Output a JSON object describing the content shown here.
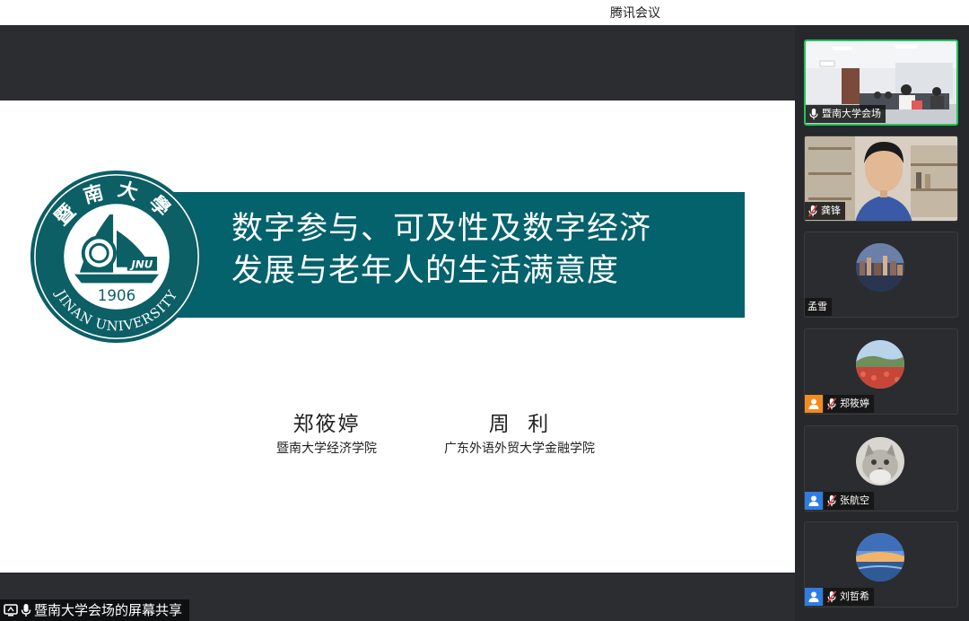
{
  "window": {
    "title": "腾讯会议"
  },
  "slide": {
    "title_line1": "数字参与、可及性及数字经济",
    "title_line2": "发展与老年人的生活满意度",
    "logo": {
      "top_text": "暨南大學",
      "bottom_text": "JINAN UNIVERSITY",
      "year": "1906",
      "badge": "JNU"
    },
    "authors": [
      {
        "name": "郑筱婷",
        "affiliation": "暨南大学经济学院"
      },
      {
        "name": "周  利",
        "affiliation": "广东外语外贸大学金融学院"
      }
    ],
    "colors": {
      "banner": "#03626c"
    }
  },
  "share": {
    "label": "暨南大学会场的屏幕共享"
  },
  "participants": [
    {
      "name": "暨南大学会场",
      "mic": "on",
      "badge": "none",
      "active": true
    },
    {
      "name": "龚锋",
      "mic": "muted",
      "badge": "none",
      "active": false
    },
    {
      "name": "孟雪",
      "mic": "none",
      "badge": "none",
      "active": false
    },
    {
      "name": "郑筱婷",
      "mic": "muted",
      "badge": "orange-user-icon",
      "active": false
    },
    {
      "name": "张航空",
      "mic": "muted",
      "badge": "blue-user-icon",
      "active": false
    },
    {
      "name": "刘哲希",
      "mic": "muted",
      "badge": "blue-user-icon",
      "active": false
    }
  ]
}
